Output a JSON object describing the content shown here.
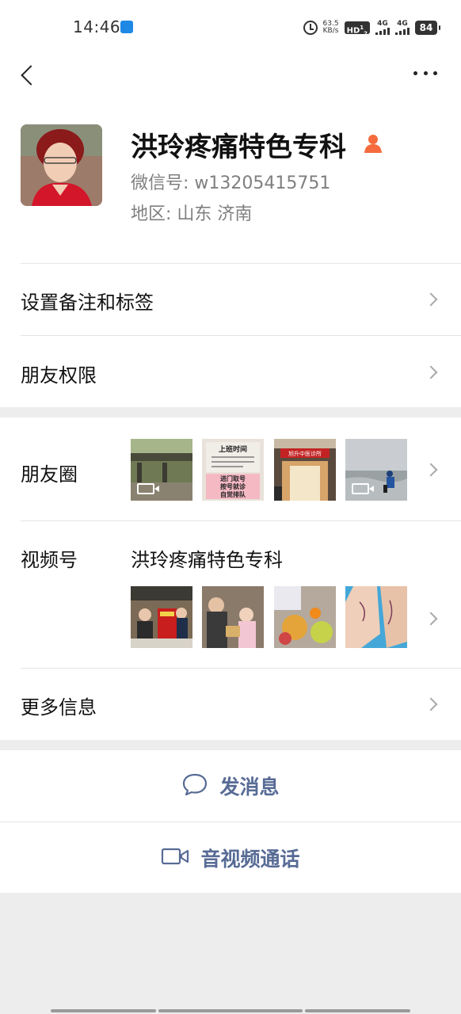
{
  "status_bar": {
    "time": "14:46",
    "net_speed_value": "63.5",
    "net_speed_unit": "KB/s",
    "hd_label": "HD",
    "hd_sub": "1",
    "hd_sub2": "2",
    "signal1_label": "4G",
    "signal2_label": "4G",
    "battery": "84"
  },
  "profile": {
    "name": "洪玲疼痛特色专科",
    "wechat_id": "微信号:  w13205415751",
    "region": "地区:  山东  济南"
  },
  "rows": {
    "remark": "设置备注和标签",
    "permissions": "朋友权限",
    "moments": "朋友圈",
    "channels": "视频号",
    "channels_name": "洪玲疼痛特色专科",
    "more_info": "更多信息"
  },
  "moments_thumbs": [
    {
      "type": "video",
      "icon": "video-icon"
    },
    {
      "type": "image",
      "text_line1": "上班时间",
      "text_line2": "进门取号",
      "text_line3": "按号就诊",
      "text_line4": "自觉排队"
    },
    {
      "type": "image",
      "sign": "旭升中医诊所"
    },
    {
      "type": "video",
      "icon": "video-icon"
    }
  ],
  "actions": {
    "message": "发消息",
    "call": "音视频通话"
  },
  "colors": {
    "link_blue": "#576b95",
    "background": "#ededed",
    "person_icon": "#f56b3d"
  }
}
